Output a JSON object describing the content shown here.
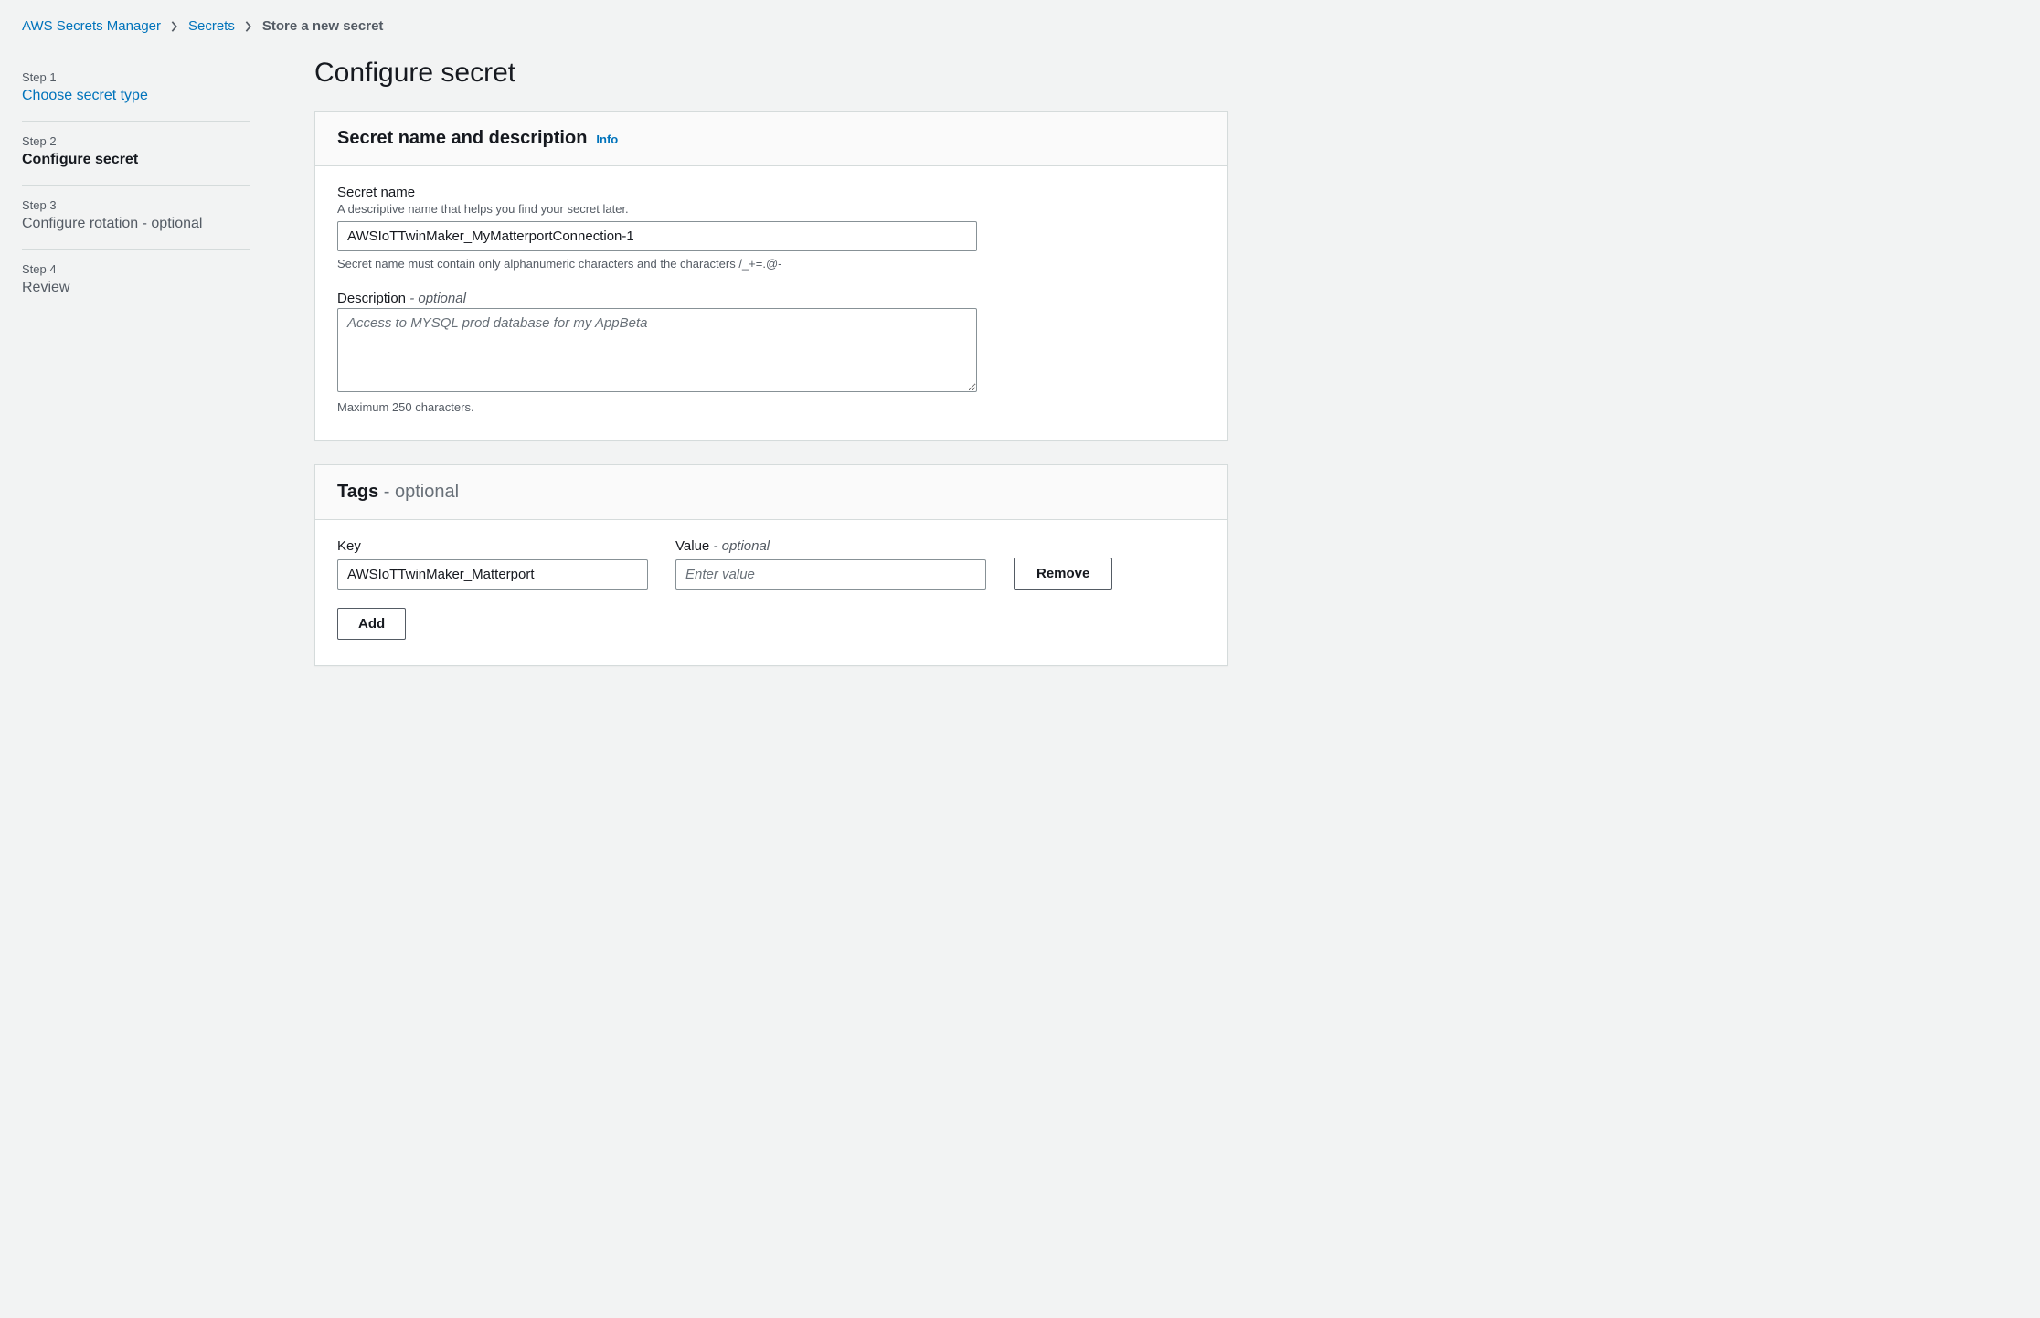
{
  "breadcrumb": {
    "items": [
      {
        "label": "AWS Secrets Manager",
        "link": true
      },
      {
        "label": "Secrets",
        "link": true
      },
      {
        "label": "Store a new secret",
        "link": false
      }
    ]
  },
  "stepnav": [
    {
      "num": "Step 1",
      "title": "Choose secret type",
      "state": "link"
    },
    {
      "num": "Step 2",
      "title": "Configure secret",
      "state": "active"
    },
    {
      "num": "Step 3",
      "title": "Configure rotation - optional",
      "state": "pending"
    },
    {
      "num": "Step 4",
      "title": "Review",
      "state": "pending"
    }
  ],
  "page": {
    "title": "Configure secret"
  },
  "panel_name": {
    "heading": "Secret name and description",
    "info_label": "Info",
    "secret_name": {
      "label": "Secret name",
      "help": "A descriptive name that helps you find your secret later.",
      "value": "AWSIoTTwinMaker_MyMatterportConnection-1",
      "constraint": "Secret name must contain only alphanumeric characters and the characters /_+=.@-"
    },
    "description": {
      "label": "Description",
      "optional_suffix": "- optional",
      "placeholder": "Access to MYSQL prod database for my AppBeta",
      "value": "",
      "constraint": "Maximum 250 characters."
    }
  },
  "panel_tags": {
    "heading": "Tags",
    "optional_suffix": "- optional",
    "key_label": "Key",
    "value_label": "Value",
    "value_optional_suffix": "- optional",
    "row": {
      "key_value": "AWSIoTTwinMaker_Matterport",
      "value_value": "",
      "value_placeholder": "Enter value"
    },
    "remove_label": "Remove",
    "add_label": "Add"
  }
}
